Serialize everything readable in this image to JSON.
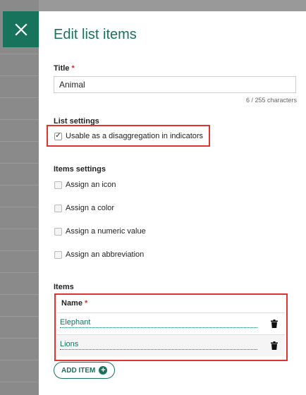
{
  "dialog": {
    "title": "Edit list items"
  },
  "title_field": {
    "label": "Title",
    "required_marker": "*",
    "value": "Animal",
    "char_count": "6 / 255 characters"
  },
  "list_settings": {
    "heading": "List settings",
    "disaggregation_label": "Usable as a disaggregation in indicators",
    "disaggregation_checked": true
  },
  "items_settings": {
    "heading": "Items settings",
    "options": [
      {
        "label": "Assign an icon",
        "checked": false
      },
      {
        "label": "Assign a color",
        "checked": false
      },
      {
        "label": "Assign a numeric value",
        "checked": false
      },
      {
        "label": "Assign an abbreviation",
        "checked": false
      }
    ]
  },
  "items": {
    "heading": "Items",
    "column_name": "Name",
    "required_marker": "*",
    "rows": [
      {
        "name": "Elephant"
      },
      {
        "name": "Lions"
      }
    ],
    "add_label": "ADD ITEM"
  },
  "icons": {
    "close": "close-icon",
    "delete": "trash-icon",
    "add": "plus-circle-icon"
  },
  "colors": {
    "accent": "#17735c",
    "highlight": "#e03333"
  }
}
